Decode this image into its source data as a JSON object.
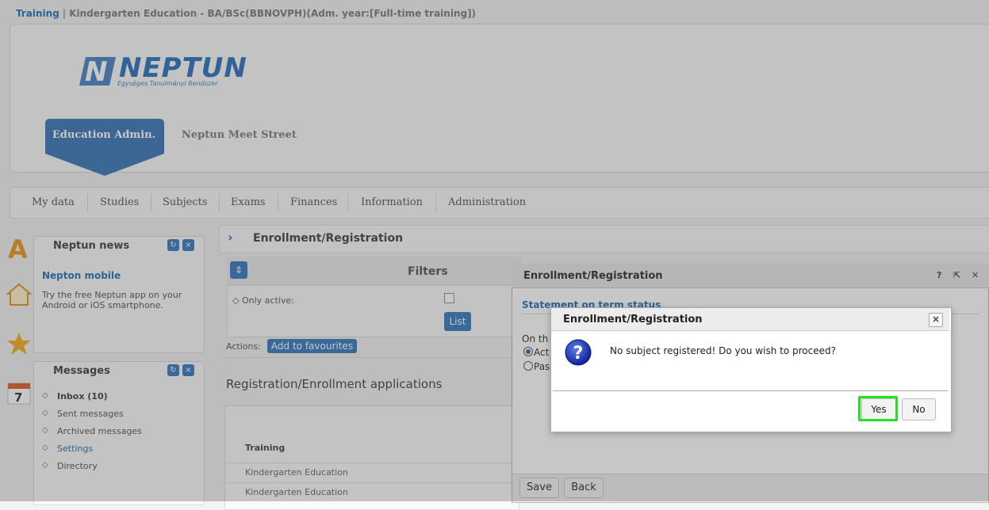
{
  "breadcrumb": {
    "training_label": "Training",
    "separator": "|",
    "program": "Kindergarten Education - BA/BSc(BBNOVPH)(Adm. year:[Full-time training])"
  },
  "header": {
    "logo_text": "NEPTUN",
    "logo_subtitle": "Egységes Tanulmányi Rendszer",
    "tabs": [
      {
        "label": "Education Admin."
      },
      {
        "label": "Neptun Meet Street"
      }
    ]
  },
  "menu": {
    "items": [
      "My data",
      "Studies",
      "Subjects",
      "Exams",
      "Finances",
      "Information",
      "Administration"
    ]
  },
  "news_widget": {
    "title": "Neptun news",
    "link": "Nepton mobile",
    "text": "Try the free Neptun app on your Android or iOS smartphone."
  },
  "messages_widget": {
    "title": "Messages",
    "items": [
      "Inbox (10)",
      "Sent messages",
      "Archived messages",
      "Settings",
      "Directory"
    ]
  },
  "content": {
    "title": "Enrollment/Registration",
    "filters_title": "Filters",
    "only_active_label": "Only active:",
    "list_button": "List",
    "actions_label": "Actions:",
    "add_favourites": "Add to favourites",
    "section_title": "Registration/Enrollment applications",
    "table": {
      "header_training": "Training",
      "rows": [
        "Kindergarten Education",
        "Kindergarten Education"
      ]
    }
  },
  "parent_dialog": {
    "title": "Enrollment/Registration",
    "help": "?",
    "statement_link": "Statement on term status",
    "on_the": "On th",
    "radio_active": "Act",
    "radio_passive": "Pas",
    "save_button": "Save",
    "back_button": "Back"
  },
  "confirm_dialog": {
    "title": "Enrollment/Registration",
    "close": "×",
    "message": "No subject registered! Do you wish to proceed?",
    "yes_button": "Yes",
    "no_button": "No"
  },
  "colors": {
    "accent": "#3a7fbf",
    "highlight": "#22e022"
  }
}
